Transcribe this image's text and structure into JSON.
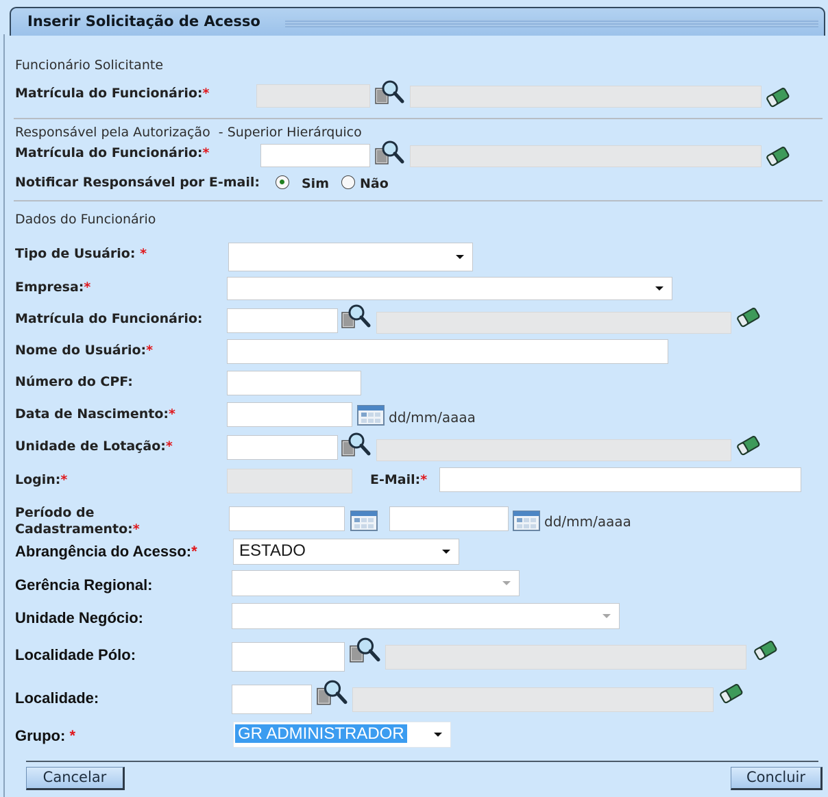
{
  "title": "Inserir Solicitação de Acesso",
  "required_mark": "*",
  "sections": {
    "solicitante": "Funcionário Solicitante",
    "responsavel": "Responsável pela Autorização",
    "responsavel_sub": "- Superior Hierárquico",
    "dados": "Dados do Funcionário"
  },
  "labels": {
    "matricula_solicitante": "Matrícula do Funcionário:",
    "matricula_responsavel": "Matrícula do Funcionário:",
    "notificar": "Notificar Responsável por E-mail:",
    "sim": "Sim",
    "nao": "Não",
    "tipo_usuario": "Tipo de Usuário:",
    "empresa": "Empresa:",
    "matricula_funcionario": "Matrícula do Funcionário:",
    "nome_usuario": "Nome do Usuário:",
    "cpf": "Número do CPF:",
    "data_nascimento": "Data de Nascimento:",
    "unidade_lotacao": "Unidade de Lotação:",
    "login": "Login:",
    "email": "E-Mail:",
    "periodo_line1": "Período de",
    "periodo_line2": "Cadastramento:",
    "abrangencia": "Abrangência do Acesso:",
    "gerencia": "Gerência Regional:",
    "unidade_negocio": "Unidade Negócio:",
    "localidade_polo": "Localidade Pólo:",
    "localidade": "Localidade:",
    "grupo": "Grupo:"
  },
  "values": {
    "abrangencia": "ESTADO",
    "grupo": "GR ADMINISTRADOR",
    "notificar_selected": "Sim"
  },
  "hints": {
    "date_format": "dd/mm/aaaa"
  },
  "buttons": {
    "cancelar": "Cancelar",
    "concluir": "Concluir"
  },
  "icons": {
    "search": "search-icon",
    "eraser": "eraser-icon",
    "calendar": "calendar-icon"
  }
}
